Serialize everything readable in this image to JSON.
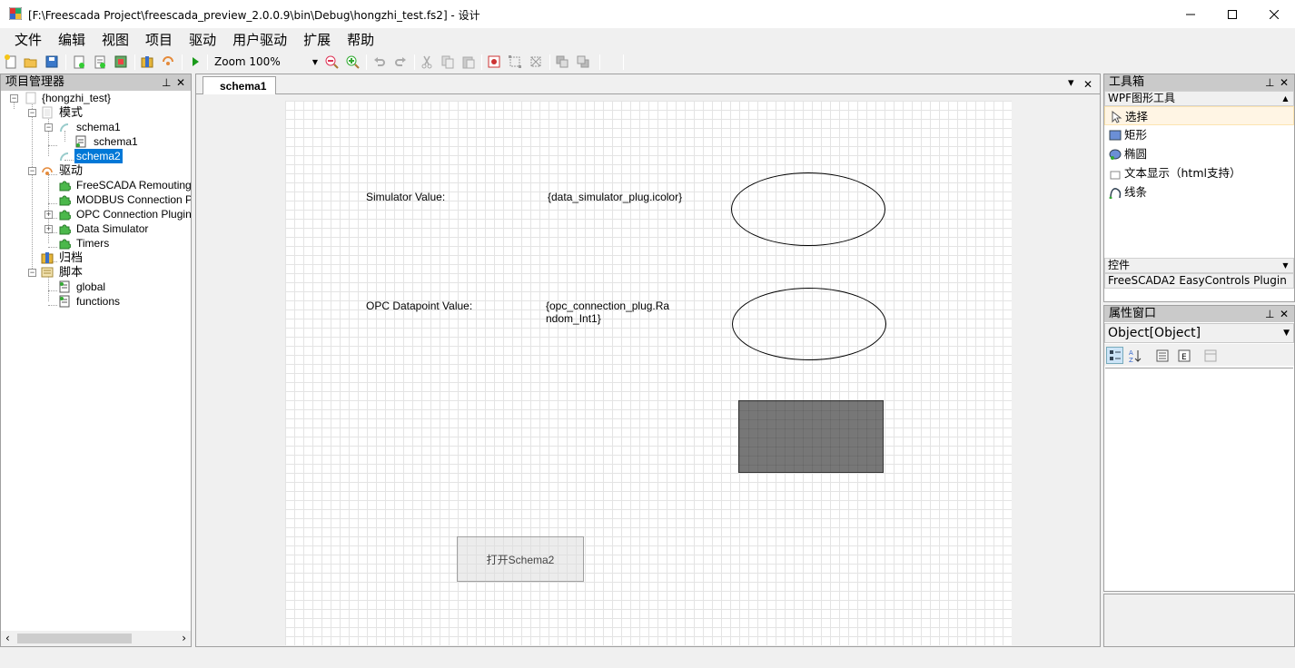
{
  "window": {
    "title": "[F:\\Freescada Project\\freescada_preview_2.0.0.9\\bin\\Debug\\hongzhi_test.fs2] - 设计",
    "minimize": "—",
    "maximize": "☐",
    "close": "✕"
  },
  "menu": [
    "文件",
    "编辑",
    "视图",
    "项目",
    "驱动",
    "用户驱动",
    "扩展",
    "帮助"
  ],
  "toolbar": {
    "zoom": "Zoom 100%"
  },
  "project_panel": {
    "title": "项目管理器",
    "pin": "⊥",
    "close": "✕",
    "tree": {
      "root": "{hongzhi_test}",
      "schemas_label": "模式",
      "schema1_folder": "schema1",
      "schema1_item": "schema1",
      "schema2": "schema2",
      "drivers_label": "驱动",
      "drivers": [
        "FreeSCADA Remouting Co",
        "MODBUS Connection Plug",
        "OPC Connection Plugin",
        "Data Simulator",
        "Timers"
      ],
      "archive_label": "归档",
      "scripts_label": "脚本",
      "scripts": [
        "global",
        "functions"
      ]
    }
  },
  "document": {
    "tab_label": "schema1",
    "dropdown": "▾",
    "close": "✕",
    "canvas": {
      "simulator_label": "Simulator Value:",
      "simulator_binding": "{data_simulator_plug.icolor}",
      "opc_label": "OPC Datapoint Value:",
      "opc_binding_line1": "{opc_connection_plug.Ra",
      "opc_binding_line2": "ndom_Int1}",
      "button_label": "打开Schema2"
    }
  },
  "toolbox": {
    "title": "工具箱",
    "pin": "⊥",
    "close": "✕",
    "group_wpf": "WPF图形工具",
    "tools": [
      "选择",
      "矩形",
      "椭圆",
      "文本显示（html支持）",
      "线条"
    ],
    "group_controls": "控件",
    "controls_item": "FreeSCADA2 EasyControls Plugin"
  },
  "properties": {
    "title": "属性窗口",
    "pin": "⊥",
    "close": "✕",
    "object": "Object[Object]"
  }
}
